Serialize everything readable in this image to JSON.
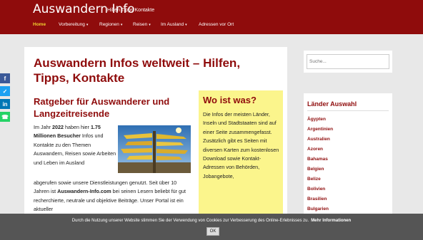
{
  "header": {
    "title": "Auswandern Info",
    "tagline": "Hilfen Tipps Kontakte"
  },
  "nav": {
    "items": [
      {
        "label": "Home",
        "active": true,
        "dropdown": false
      },
      {
        "label": "Vorbereitung",
        "active": false,
        "dropdown": true
      },
      {
        "label": "Regionen",
        "active": false,
        "dropdown": true
      },
      {
        "label": "Reisen",
        "active": false,
        "dropdown": true
      },
      {
        "label": "Im Ausland",
        "active": false,
        "dropdown": true
      },
      {
        "label": "Adressen vor Ort",
        "active": false,
        "dropdown": false
      }
    ]
  },
  "main": {
    "title": "Auswandern Infos weltweit – Hilfen, Tipps, Kontakte",
    "subtitle": "Ratgeber für Auswanderer und Langzeitreisende",
    "intro": {
      "p1": "Im Jahr ",
      "year": "2022",
      "p2": " haben hier ",
      "visitors": "1.75 Millionen Besucher",
      "p3": " Infos und Kontakte zu den Themen Auswandern, Reisen sowie Arbeiten und Leben im Ausland"
    },
    "body": {
      "p1": "abgerufen sowie unsere Dienstleistungen genutzt. Seit über 10 Jahren ist ",
      "site": "Auswandern-Info.com",
      "p2": " bei seinen Lesern beliebt für gut recherchierte, neutrale und objektive Beiträge. Unser Portal ist ein aktueller"
    }
  },
  "sidebar_box": {
    "title": "Wo ist was?",
    "text": "Die Infos der meisten Länder, Inseln und Stadtstaaten sind auf einer Seite zusammengefasst. Zusätzlich gibt es Seiten mit diversen Karten zum kostenlosen Download sowie Kontakt-Adressen von Behörden, Jobangebote,"
  },
  "search": {
    "placeholder": "Suche..."
  },
  "countries": {
    "title": "Länder Auswahl",
    "items": [
      "Ägypten",
      "Argentinien",
      "Australien",
      "Azoren",
      "Bahamas",
      "Belgien",
      "Belize",
      "Bolivien",
      "Brasilien",
      "Bulgarien"
    ]
  },
  "share": {
    "icons": [
      "facebook-icon",
      "twitter-icon",
      "linkedin-icon",
      "whatsapp-icon"
    ],
    "colors": [
      "#3b5998",
      "#1da1f2",
      "#0077b5",
      "#25d366"
    ]
  },
  "cookie": {
    "text": "Durch die Nutzung unserer Website stimmen Sie der Verwendung von Cookies zur Verbesserung des Online-Erlebnisses zu.",
    "link": "Mehr Informationen",
    "ok": "OK"
  },
  "colors": {
    "brand": "#8f0c0c",
    "nav_active": "#f2d230",
    "highlight_box": "#fbf58c"
  }
}
